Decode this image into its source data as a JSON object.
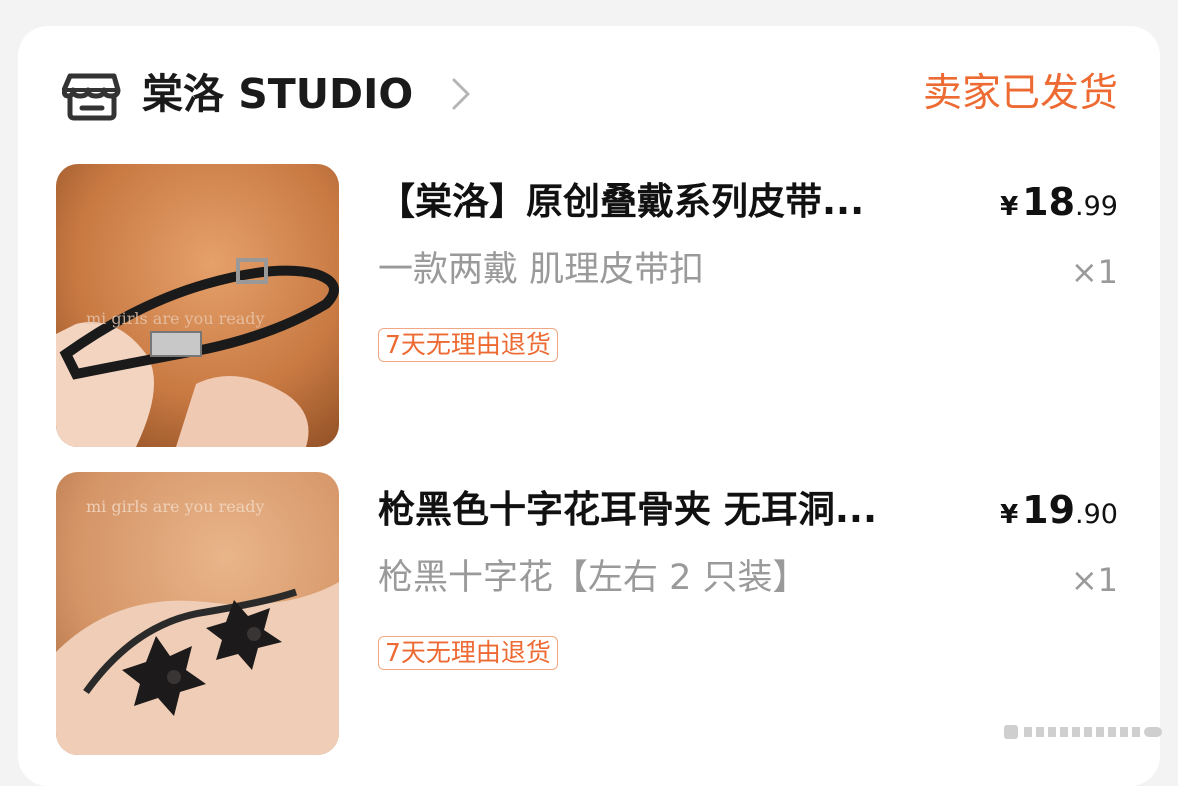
{
  "shop": {
    "name": "棠洛 STUDIO",
    "status": "卖家已发货",
    "icon": "store-icon",
    "accent_color": "#ee6a33"
  },
  "items": [
    {
      "title": "【棠洛】原创叠戴系列皮带...",
      "price_currency": "¥",
      "price_int": "18",
      "price_dec": ".99",
      "spec": "一款两戴 肌理皮带扣",
      "qty": "×1",
      "tag": "7天无理由退货",
      "image_overlay_text": "mi girls are you ready"
    },
    {
      "title": "枪黑色十字花耳骨夹 无耳洞...",
      "price_currency": "¥",
      "price_int": "19",
      "price_dec": ".90",
      "spec": "枪黑十字花【左右 2 只装】",
      "qty": "×1",
      "tag": "7天无理由退货",
      "image_overlay_text": "mi girls are you ready"
    }
  ]
}
